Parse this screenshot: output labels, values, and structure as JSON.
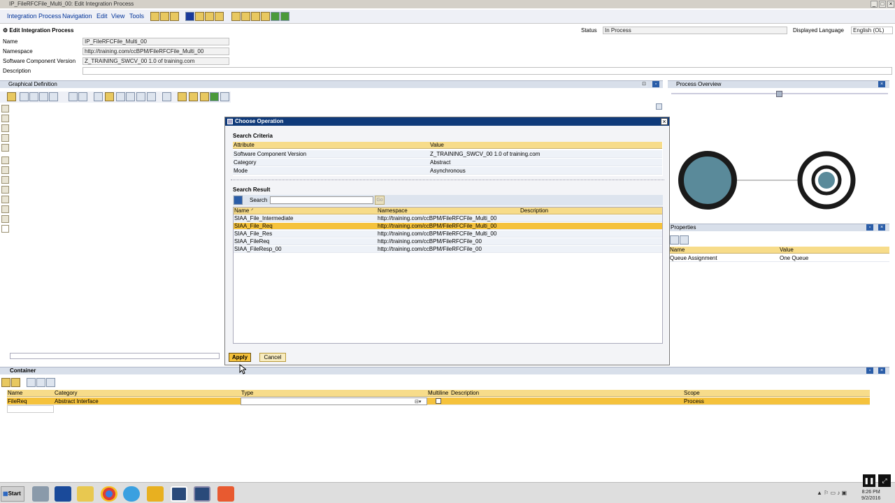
{
  "window": {
    "title": "IP_FileRFCFile_Multi_00: Edit Integration Process"
  },
  "menu": [
    "Integration Process",
    "Navigation",
    "Edit",
    "View",
    "Tools"
  ],
  "header": {
    "title": "Edit Integration Process",
    "status_label": "Status",
    "status_value": "In Process",
    "language_label": "Displayed Language",
    "language_value": "English (OL)"
  },
  "form": {
    "name_label": "Name",
    "name_value": "IP_FileRFCFile_Multi_00",
    "namespace_label": "Namespace",
    "namespace_value": "http://training.com/ccBPM/FileRFCFile_Multi_00",
    "swcv_label": "Software Component Version",
    "swcv_value": "Z_TRAINING_SWCV_00 1.0 of training.com",
    "description_label": "Description",
    "description_value": ""
  },
  "panels": {
    "graphical": "Graphical Definition",
    "overview": "Process Overview",
    "properties": "Properties",
    "container": "Container"
  },
  "properties": {
    "columns": [
      "Name",
      "Value"
    ],
    "rows": [
      [
        "Queue Assignment",
        "One Queue"
      ]
    ]
  },
  "container": {
    "columns": [
      "Name",
      "Category",
      "Type",
      "Multiline",
      "Description",
      "Scope"
    ],
    "row": {
      "name": "FileReq",
      "category": "Abstract Interface",
      "type": "",
      "description": "",
      "scope": "Process"
    }
  },
  "dialog": {
    "title": "Choose Operation",
    "criteria_title": "Search Criteria",
    "criteria_columns": [
      "Attribute",
      "Value"
    ],
    "criteria": [
      [
        "Software Component Version",
        "Z_TRAINING_SWCV_00 1.0 of training.com"
      ],
      [
        "Category",
        "Abstract"
      ],
      [
        "Mode",
        "Asynchronous"
      ]
    ],
    "result_title": "Search Result",
    "search_label": "Search",
    "search_value": "",
    "go_label": "Go",
    "result_columns": [
      "Name",
      "Namespace",
      "Description"
    ],
    "results": [
      [
        "SIAA_File_Intermediate",
        "http://training.com/ccBPM/FileRFCFile_Multi_00",
        ""
      ],
      [
        "SIAA_File_Req",
        "http://training.com/ccBPM/FileRFCFile_Multi_00",
        ""
      ],
      [
        "SIAA_File_Res",
        "http://training.com/ccBPM/FileRFCFile_Multi_00",
        ""
      ],
      [
        "SIAA_FileReq",
        "http://training.com/ccBPM/FileRFCFile_00",
        ""
      ],
      [
        "SIAA_FileResp_00",
        "http://training.com/ccBPM/FileRFCFile_00",
        ""
      ]
    ],
    "selected_index": 1,
    "apply_label": "Apply",
    "cancel_label": "Cancel"
  },
  "taskbar": {
    "start_label": "Start",
    "time": "8:26 PM",
    "date": "9/2/2016"
  }
}
